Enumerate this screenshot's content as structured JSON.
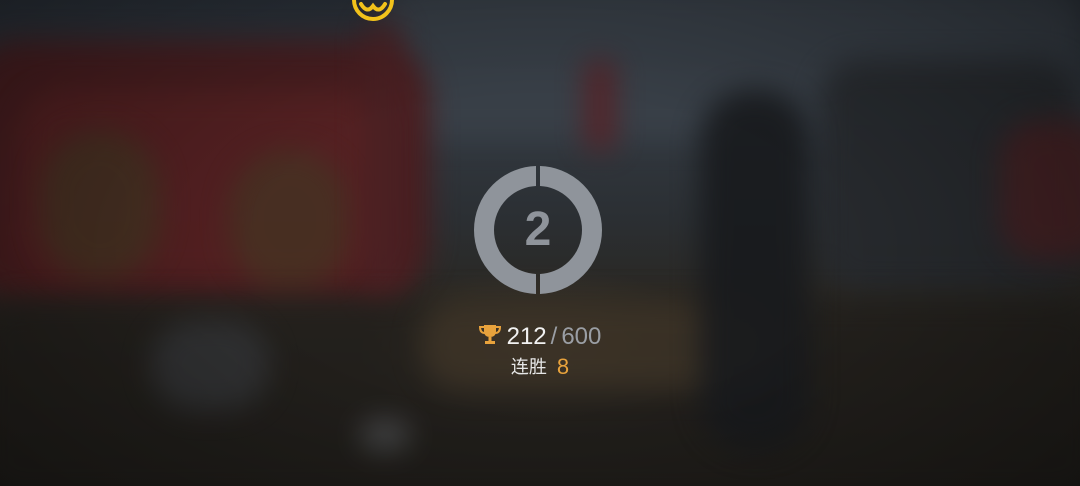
{
  "colors": {
    "accent_gold": "#e8a23c",
    "emblem_yellow": "#f2c21b",
    "badge_gray": "#8f949b",
    "text_primary": "#f1f1f1",
    "text_secondary": "#9a9ea4"
  },
  "top_emblem": {
    "icon": "emblem-icon"
  },
  "rank": {
    "icon": "rank-badge-icon",
    "number": "2"
  },
  "score": {
    "icon": "trophy-icon",
    "current": "212",
    "separator": "/",
    "max": "600"
  },
  "streak": {
    "label": "连胜",
    "value": "8"
  }
}
